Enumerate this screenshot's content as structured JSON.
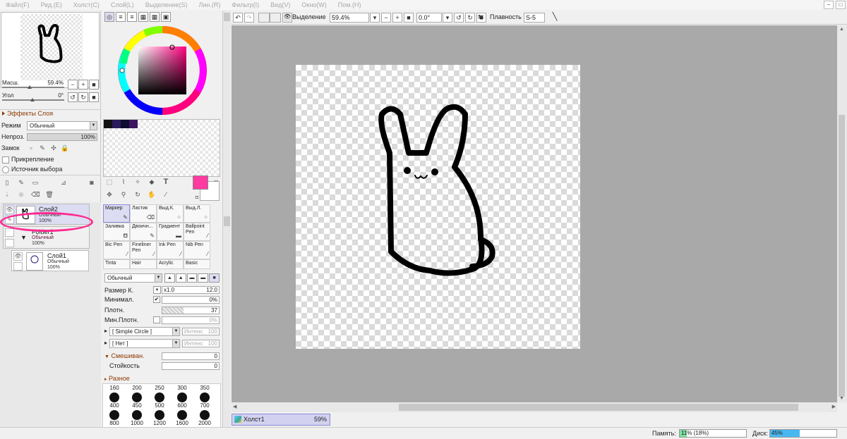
{
  "menu": [
    "Файл(F)",
    "Ред.(E)",
    "Холст(C)",
    "Слой(L)",
    "Выделение(S)",
    "Лин.(R)",
    "Фильтр(I)",
    "Вид(V)",
    "Окно(W)",
    "Пом.(H)"
  ],
  "window_buttons": [
    "−",
    "□"
  ],
  "navigator": {
    "zoom_label": "Масш.",
    "zoom_value": "59.4%",
    "zoom_level_pct": 59.4,
    "angle_label": "Угол",
    "angle_value": "0°"
  },
  "layer_effects": {
    "title": "Эффекты Слоя",
    "mode_label": "Режим",
    "mode_value": "Обычный",
    "opacity_label": "Непроз.",
    "opacity_value": "100%",
    "lock_label": "Замок",
    "clip_label": "Прикрепление",
    "selsource_label": "Источник выбора"
  },
  "layers": [
    {
      "name": "Слой2",
      "mode": "Обычный",
      "opacity": "100%",
      "selected": true
    },
    {
      "name": "Folder1",
      "mode": "Обычный",
      "opacity": "100%",
      "selected": false
    },
    {
      "name": "Слой1",
      "mode": "Обычный",
      "opacity": "100%",
      "selected": false
    }
  ],
  "colors": {
    "accent": "#ff3aa0",
    "primary": "#ff3aa0",
    "secondary": "#ffffff",
    "swatches": [
      "#111111",
      "#2a1a5a",
      "#0d0d30",
      "#3a1460"
    ]
  },
  "tools": [
    {
      "label": "Маркер",
      "selected": true
    },
    {
      "label": "Ластик"
    },
    {
      "label": "Выд.К."
    },
    {
      "label": "Выд.Л."
    },
    {
      "label": "Заливка"
    },
    {
      "label": "Двоичн..."
    },
    {
      "label": "Градиент"
    },
    {
      "label": "Ballpoint Pen"
    },
    {
      "label": "Bic Pen"
    },
    {
      "label": "Fineliner Pen"
    },
    {
      "label": "Ink Pen"
    },
    {
      "label": "Nib Pen"
    },
    {
      "label": "Tinta"
    },
    {
      "label": "Hair"
    },
    {
      "label": "Acrylic"
    },
    {
      "label": "Basic"
    }
  ],
  "brush": {
    "blend_mode": "Обычный",
    "size_label": "Размер К.",
    "size_mult": "x1.0",
    "size_value": "12.0",
    "min_label": "Минимал.",
    "min_value": "0%",
    "density_label": "Плотн.",
    "density_value": "37",
    "mindensity_label": "Мин.Плотн.",
    "mindensity_value": "0%",
    "shape": "[ Simple Circle ]",
    "texture": "[ Нет ]",
    "intensity_label": "Интенс",
    "intensity_value": "100",
    "blending_title": "Смешиван.",
    "blending_value": "0",
    "persistence_label": "Стойкость",
    "persistence_value": "0",
    "misc_title": "Разное"
  },
  "brush_sizes_row1": [
    "160",
    "200",
    "250",
    "300",
    "350"
  ],
  "brush_sizes_row2": [
    "400",
    "450",
    "500",
    "600",
    "700"
  ],
  "brush_sizes_row3": [
    "800",
    "1000",
    "1200",
    "1600",
    "2000"
  ],
  "canvas_toolbar": {
    "selection_label": "Выделение",
    "zoom_value": "59.4%",
    "angle_value": "0.0°",
    "smoothing_label": "Плавность",
    "smoothing_value": "S-5"
  },
  "canvas_tab": {
    "name": "Холст1",
    "zoom": "59%"
  },
  "status": {
    "memory_label": "Память:",
    "memory_value": "11% (18%)",
    "memory_fraction": 0.11,
    "disk_label": "Диск:",
    "disk_value": "45%",
    "disk_fraction": 0.45
  }
}
